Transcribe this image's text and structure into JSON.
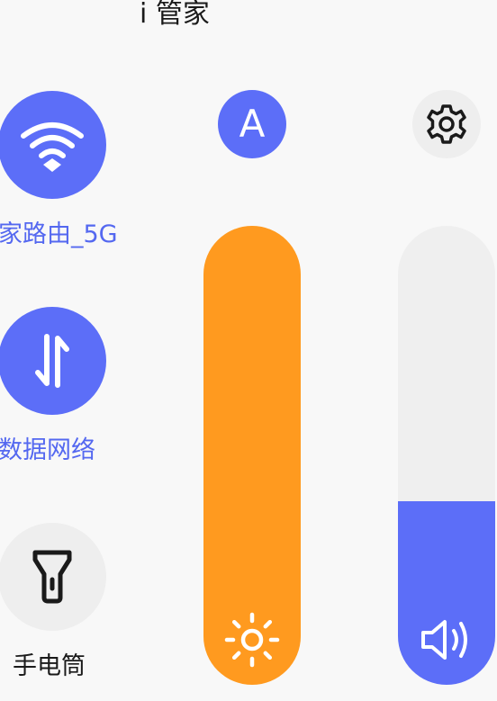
{
  "header": {
    "title": "i 管家"
  },
  "tiles": {
    "wifi": {
      "label": "家路由_5G",
      "icon": "wifi-icon",
      "active": true
    },
    "mobile_data": {
      "label": "数据网络",
      "icon": "data-transfer-icon",
      "active": true
    },
    "flashlight": {
      "label": "手电筒",
      "icon": "flashlight-icon",
      "active": false
    }
  },
  "brightness": {
    "auto_label": "A",
    "level": 1.0,
    "icon": "sun-icon",
    "color": "#ff9a1f"
  },
  "volume": {
    "level": 0.4,
    "icon": "speaker-icon",
    "color": "#5c6ef8"
  },
  "settings": {
    "icon": "gear-icon"
  },
  "colors": {
    "accent": "#5c6ef8",
    "label_accent": "#5468f0",
    "brightness": "#ff9a1f",
    "inactive": "#eeeeee",
    "background": "#f8f8f8"
  }
}
